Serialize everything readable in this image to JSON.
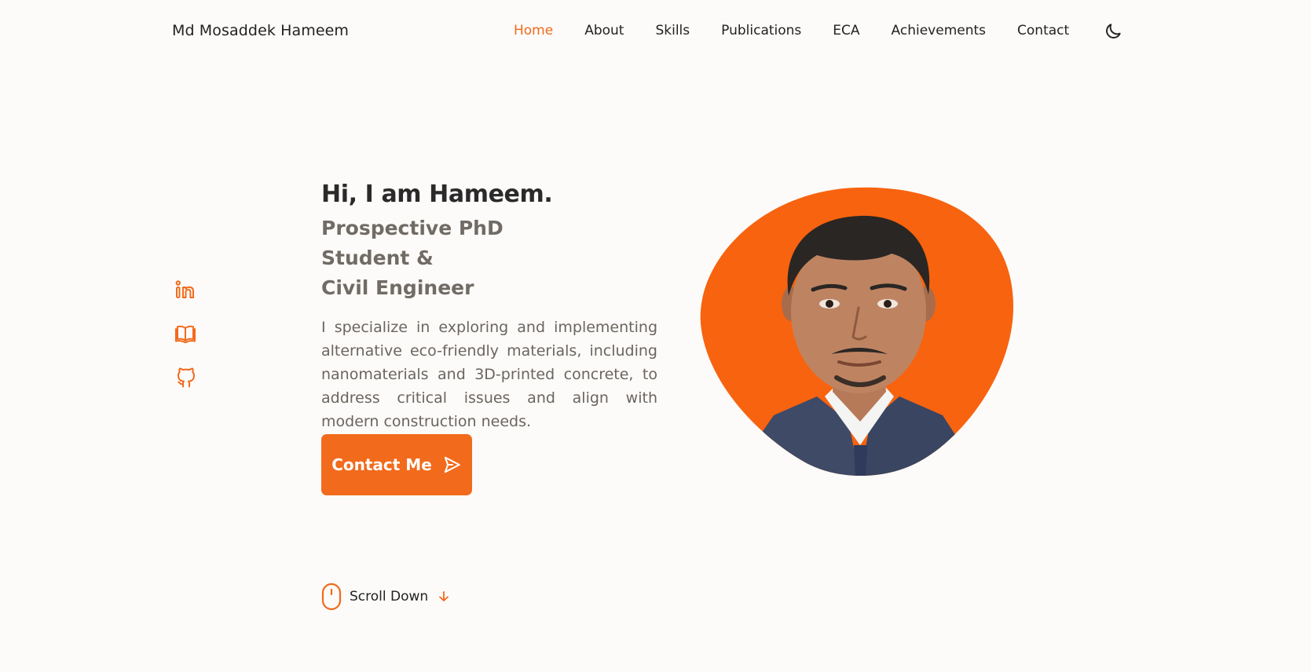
{
  "header": {
    "logo": "Md Mosaddek Hameem",
    "nav": [
      {
        "label": "Home",
        "active": true
      },
      {
        "label": "About"
      },
      {
        "label": "Skills"
      },
      {
        "label": "Publications"
      },
      {
        "label": "ECA"
      },
      {
        "label": "Achievements"
      },
      {
        "label": "Contact"
      }
    ],
    "theme_icon": "moon-icon"
  },
  "social": [
    {
      "icon": "linkedin-icon"
    },
    {
      "icon": "book-icon"
    },
    {
      "icon": "github-icon"
    }
  ],
  "hero": {
    "greeting": "Hi, I am Hameem.",
    "subtitle_line1": "Prospective PhD Student &",
    "subtitle_line2": "Civil Engineer",
    "description": "I specialize in exploring and implementing alternative eco-friendly materials, including nanomaterials and 3D-printed concrete, to address critical issues and align with modern construction needs.",
    "cta_label": "Contact Me",
    "cta_icon": "send-icon",
    "photo": "profile-photo"
  },
  "scroll": {
    "label": "Scroll Down",
    "icon": "mouse-icon",
    "arrow_icon": "arrow-down-icon"
  },
  "colors": {
    "accent": "#f26a1b",
    "background": "#fcfbf9",
    "text": "#222222",
    "muted": "#716b65"
  }
}
